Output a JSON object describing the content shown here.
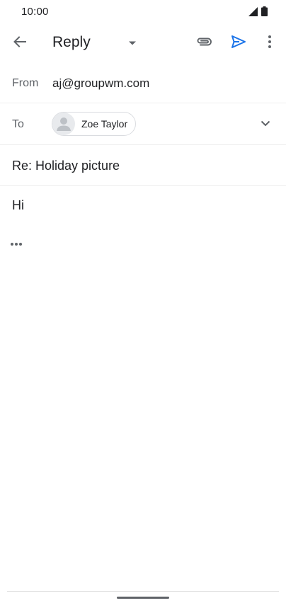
{
  "status_bar": {
    "time": "10:00",
    "icons": [
      "signal-icon",
      "battery-icon"
    ]
  },
  "toolbar": {
    "back_icon": "arrow-back-icon",
    "title": "Reply",
    "dropdown_icon": "dropdown-triangle-icon",
    "attach_icon": "paperclip-icon",
    "send_icon": "send-icon",
    "more_icon": "more-vert-icon"
  },
  "compose": {
    "from_label": "From",
    "from_value": "aj@groupwm.com",
    "to_label": "To",
    "recipients": [
      {
        "name": "Zoe Taylor",
        "avatar_icon": "person-avatar-icon"
      }
    ],
    "expand_icon": "chevron-down-icon",
    "subject": "Re: Holiday picture",
    "body": "Hi",
    "quoted_icon": "more-horiz-icon"
  },
  "colors": {
    "accent": "#1a73e8",
    "text_primary": "#202124",
    "text_secondary": "#5f6368",
    "divider": "#eeeeee"
  }
}
